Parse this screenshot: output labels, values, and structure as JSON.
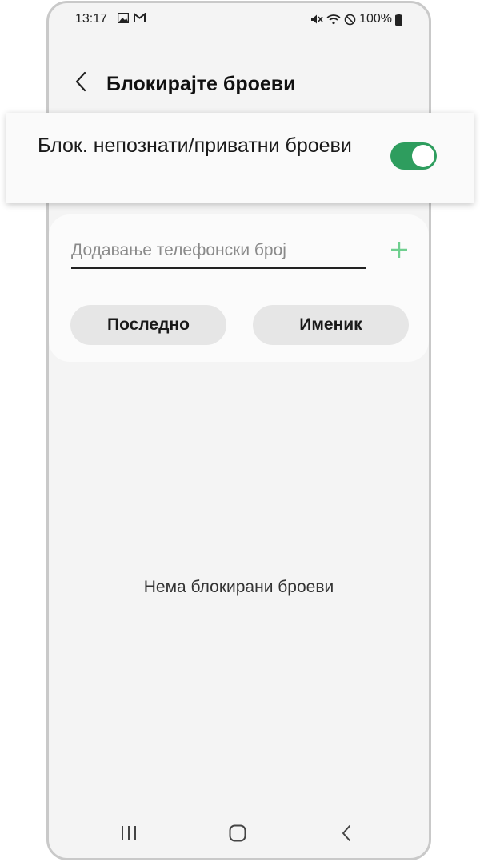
{
  "status_bar": {
    "time": "13:17",
    "battery": "100%",
    "left_icons": [
      "gallery-icon",
      "gmail-icon"
    ],
    "right_icons": [
      "mute-icon",
      "wifi-icon",
      "do-not-disturb-icon",
      "battery-icon"
    ]
  },
  "header": {
    "title": "Блокирајте броеви",
    "back_icon": "chevron-left-icon"
  },
  "block_unknown": {
    "label": "Блок. непознати/приватни броеви",
    "enabled": true,
    "accent_color": "#2e9d5e"
  },
  "add_number": {
    "placeholder": "Додавање телефонски број",
    "value": "",
    "add_icon": "plus-icon",
    "add_icon_color": "#6fcf8f"
  },
  "buttons": {
    "recent": "Последно",
    "contacts": "Именик"
  },
  "empty_state": {
    "text": "Нема блокирани броеви"
  },
  "nav_bar": {
    "items": [
      "recents-icon",
      "home-icon",
      "back-icon"
    ]
  }
}
